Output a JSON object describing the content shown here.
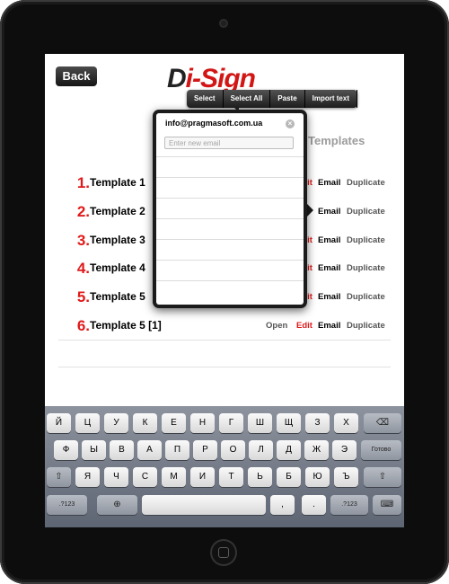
{
  "nav": {
    "back_label": "Back"
  },
  "logo": {
    "part1": "D",
    "part2": "i-Sign"
  },
  "edit_menu": {
    "items": [
      "Select",
      "Select All",
      "Paste",
      "Import text"
    ]
  },
  "section_title": "Templates",
  "templates": [
    {
      "number": "1.",
      "name": "Template 1",
      "open": "",
      "edit": "Edit",
      "email": "Email",
      "duplicate": "Duplicate"
    },
    {
      "number": "2.",
      "name": "Template 2",
      "open": "",
      "edit": "",
      "email": "Email",
      "duplicate": "Duplicate"
    },
    {
      "number": "3.",
      "name": "Template 3",
      "open": "",
      "edit": "Edit",
      "email": "Email",
      "duplicate": "Duplicate"
    },
    {
      "number": "4.",
      "name": "Template 4",
      "open": "",
      "edit": "Edit",
      "email": "Email",
      "duplicate": "Duplicate"
    },
    {
      "number": "5.",
      "name": "Template 5",
      "open": "",
      "edit": "Edit",
      "email": "Email",
      "duplicate": "Duplicate"
    },
    {
      "number": "6.",
      "name": "Template 5 [1]",
      "open": "Open",
      "edit": "Edit",
      "email": "Email",
      "duplicate": "Duplicate"
    }
  ],
  "email_popover": {
    "existing_email": "info@pragmasoft.com.ua",
    "input_placeholder": "Enter new email"
  },
  "keyboard": {
    "row1": [
      "Й",
      "Ц",
      "У",
      "К",
      "Е",
      "Н",
      "Г",
      "Ш",
      "Щ",
      "З",
      "Х"
    ],
    "row2": [
      "Ф",
      "Ы",
      "В",
      "А",
      "П",
      "Р",
      "О",
      "Л",
      "Д",
      "Ж",
      "Э"
    ],
    "row3": [
      "Я",
      "Ч",
      "С",
      "М",
      "И",
      "Т",
      "Ь",
      "Б",
      "Ю",
      "Ъ"
    ],
    "return_label": "Готово",
    "numbers_label": ".?123"
  }
}
